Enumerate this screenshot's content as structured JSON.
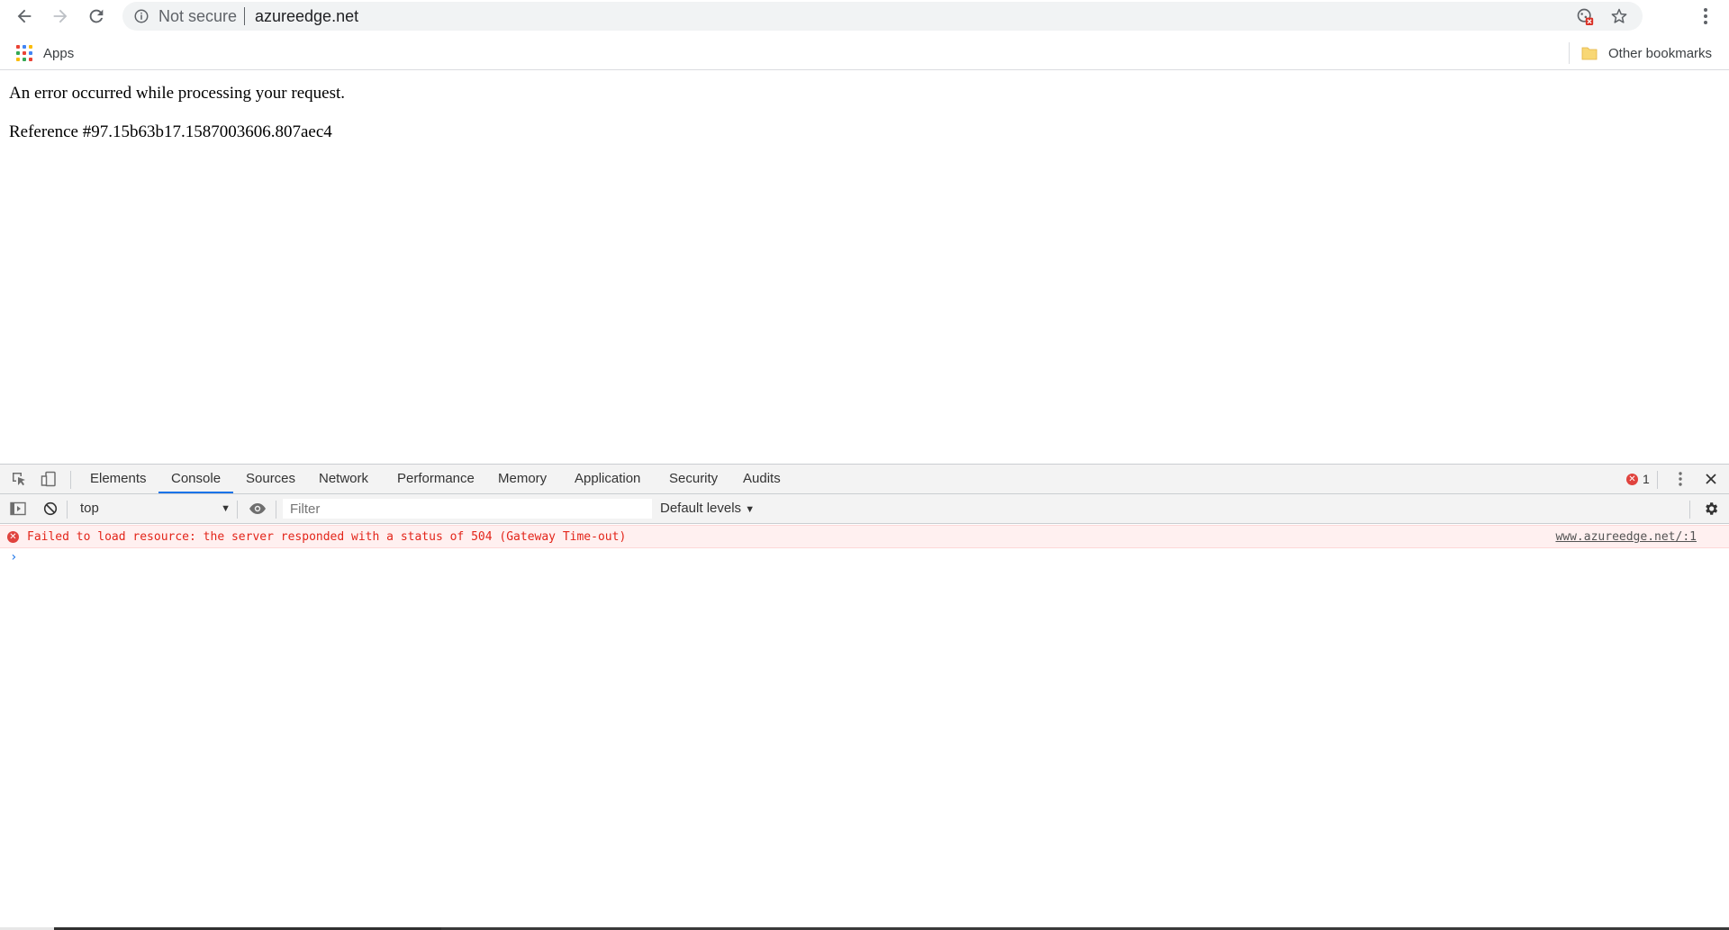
{
  "browser": {
    "address": {
      "security_label": "Not secure",
      "url": "azureedge.net"
    },
    "icons": {
      "back": "back-arrow-icon",
      "forward": "forward-arrow-icon",
      "reload": "reload-icon",
      "info": "info-icon",
      "cookie_blocked": "cookie-blocked-icon",
      "bookmark_star": "star-icon",
      "menu": "kebab-menu-icon"
    }
  },
  "bookmarks": {
    "apps_label": "Apps",
    "other_label": "Other bookmarks"
  },
  "page": {
    "message": "An error occurred while processing your request.",
    "reference": "Reference #97.15b63b17.1587003606.807aec4"
  },
  "devtools": {
    "tabs": [
      "Elements",
      "Console",
      "Sources",
      "Network",
      "Performance",
      "Memory",
      "Application",
      "Security",
      "Audits"
    ],
    "active_tab": "Console",
    "error_count": "1",
    "console": {
      "context": "top",
      "filter_placeholder": "Filter",
      "levels_label": "Default levels",
      "messages": [
        {
          "level": "error",
          "text": "Failed to load resource: the server responded with a status of 504 (Gateway Time-out)",
          "source": "www.azureedge.net/:1"
        }
      ],
      "prompt_symbol": "›"
    }
  },
  "colors": {
    "error_red": "#e3251a",
    "error_bg": "#fff0f0",
    "accent_blue": "#1a73e8",
    "toolbar_bg": "#f3f3f3"
  }
}
